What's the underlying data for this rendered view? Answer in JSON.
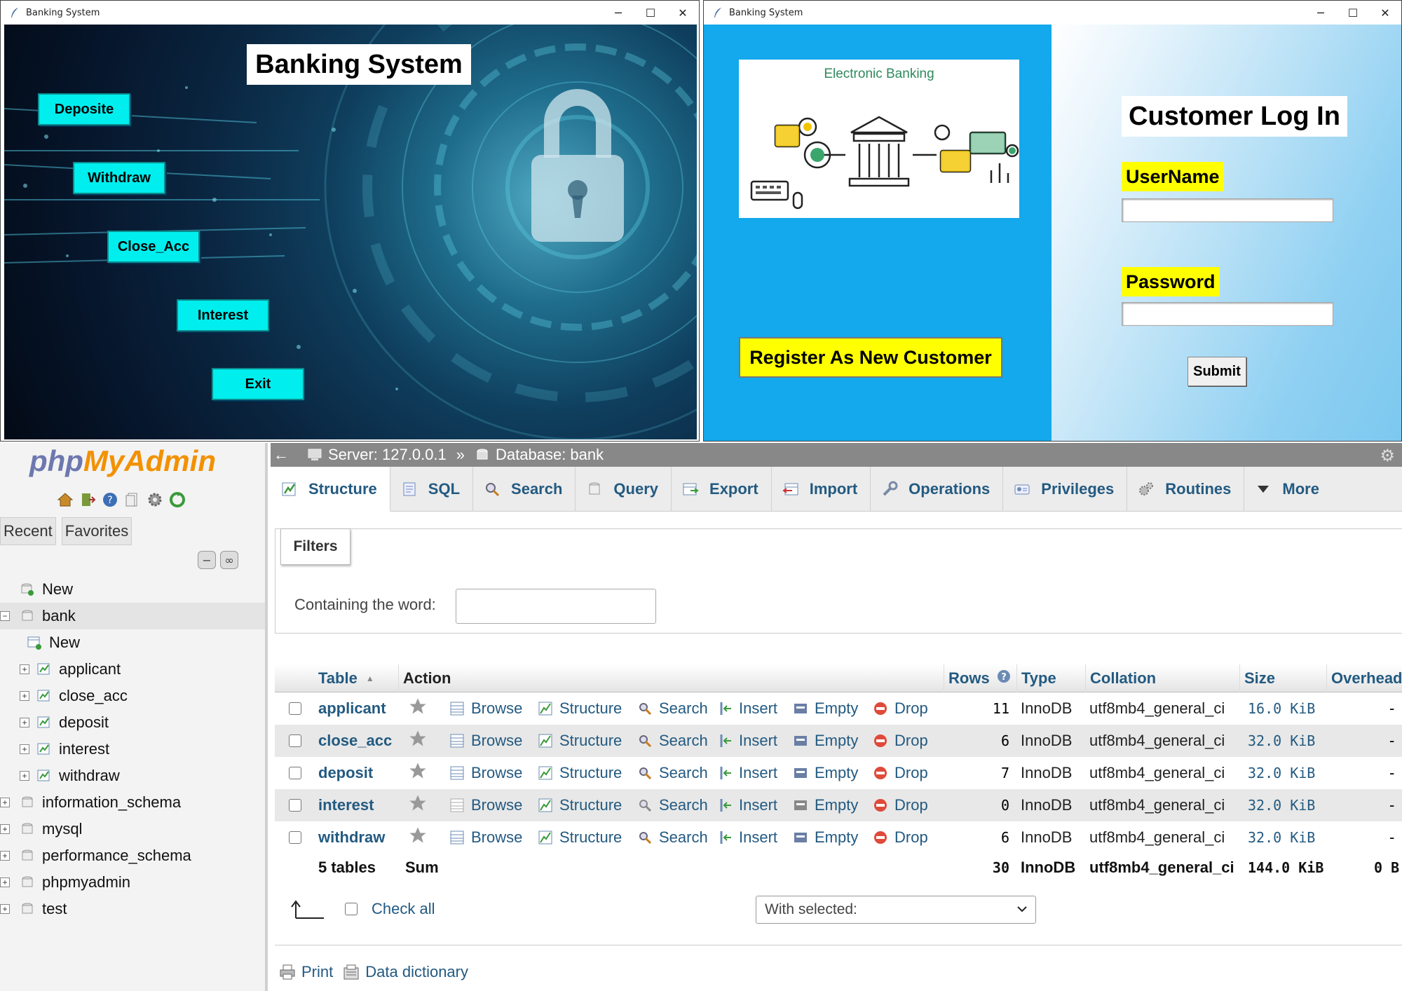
{
  "window_menu": {
    "title": "Banking System",
    "heading": "Banking System",
    "buttons": [
      "Deposite",
      "Withdraw",
      "Close_Acc",
      "Interest",
      "Exit"
    ]
  },
  "window_login": {
    "title": "Banking System",
    "card_title": "Electronic Banking",
    "register_label": "Register As New Customer",
    "heading": "Customer Log In",
    "username_label": "UserName",
    "username_value": "",
    "password_label": "Password",
    "password_value": "",
    "submit_label": "Submit"
  },
  "pma": {
    "logo_php": "php",
    "logo_ma": "MyAdmin",
    "nav_tabs": [
      "Recent",
      "Favorites"
    ],
    "tree": [
      {
        "label": "New"
      },
      {
        "label": "bank"
      },
      {
        "label": "New"
      },
      {
        "label": "applicant"
      },
      {
        "label": "close_acc"
      },
      {
        "label": "deposit"
      },
      {
        "label": "interest"
      },
      {
        "label": "withdraw"
      },
      {
        "label": "information_schema"
      },
      {
        "label": "mysql"
      },
      {
        "label": "performance_schema"
      },
      {
        "label": "phpmyadmin"
      },
      {
        "label": "test"
      }
    ],
    "breadcrumb": {
      "server": "Server: 127.0.0.1",
      "separator": "»",
      "database": "Database: bank"
    },
    "menu_tabs": [
      "Structure",
      "SQL",
      "Search",
      "Query",
      "Export",
      "Import",
      "Operations",
      "Privileges",
      "Routines",
      "More"
    ],
    "filters": {
      "legend": "Filters",
      "label": "Containing the word:",
      "value": ""
    },
    "table": {
      "headers": [
        "Table",
        "Action",
        "Rows",
        "Type",
        "Collation",
        "Size",
        "Overhead"
      ],
      "actions": [
        "Browse",
        "Structure",
        "Search",
        "Insert",
        "Empty",
        "Drop"
      ],
      "rows": [
        {
          "name": "applicant",
          "rows": "11",
          "type": "InnoDB",
          "collation": "utf8mb4_general_ci",
          "size": "16.0 KiB",
          "overhead": "-"
        },
        {
          "name": "close_acc",
          "rows": "6",
          "type": "InnoDB",
          "collation": "utf8mb4_general_ci",
          "size": "32.0 KiB",
          "overhead": "-"
        },
        {
          "name": "deposit",
          "rows": "7",
          "type": "InnoDB",
          "collation": "utf8mb4_general_ci",
          "size": "32.0 KiB",
          "overhead": "-"
        },
        {
          "name": "interest",
          "rows": "0",
          "type": "InnoDB",
          "collation": "utf8mb4_general_ci",
          "size": "32.0 KiB",
          "overhead": "-"
        },
        {
          "name": "withdraw",
          "rows": "6",
          "type": "InnoDB",
          "collation": "utf8mb4_general_ci",
          "size": "32.0 KiB",
          "overhead": "-"
        }
      ],
      "footer": {
        "tables": "5 tables",
        "sum": "Sum",
        "rows": "30",
        "type": "InnoDB",
        "collation": "utf8mb4_general_ci",
        "size": "144.0 KiB",
        "overhead": "0 B"
      }
    },
    "check_all": "Check all",
    "with_selected": "With selected:",
    "print": "Print",
    "data_dictionary": "Data dictionary"
  }
}
